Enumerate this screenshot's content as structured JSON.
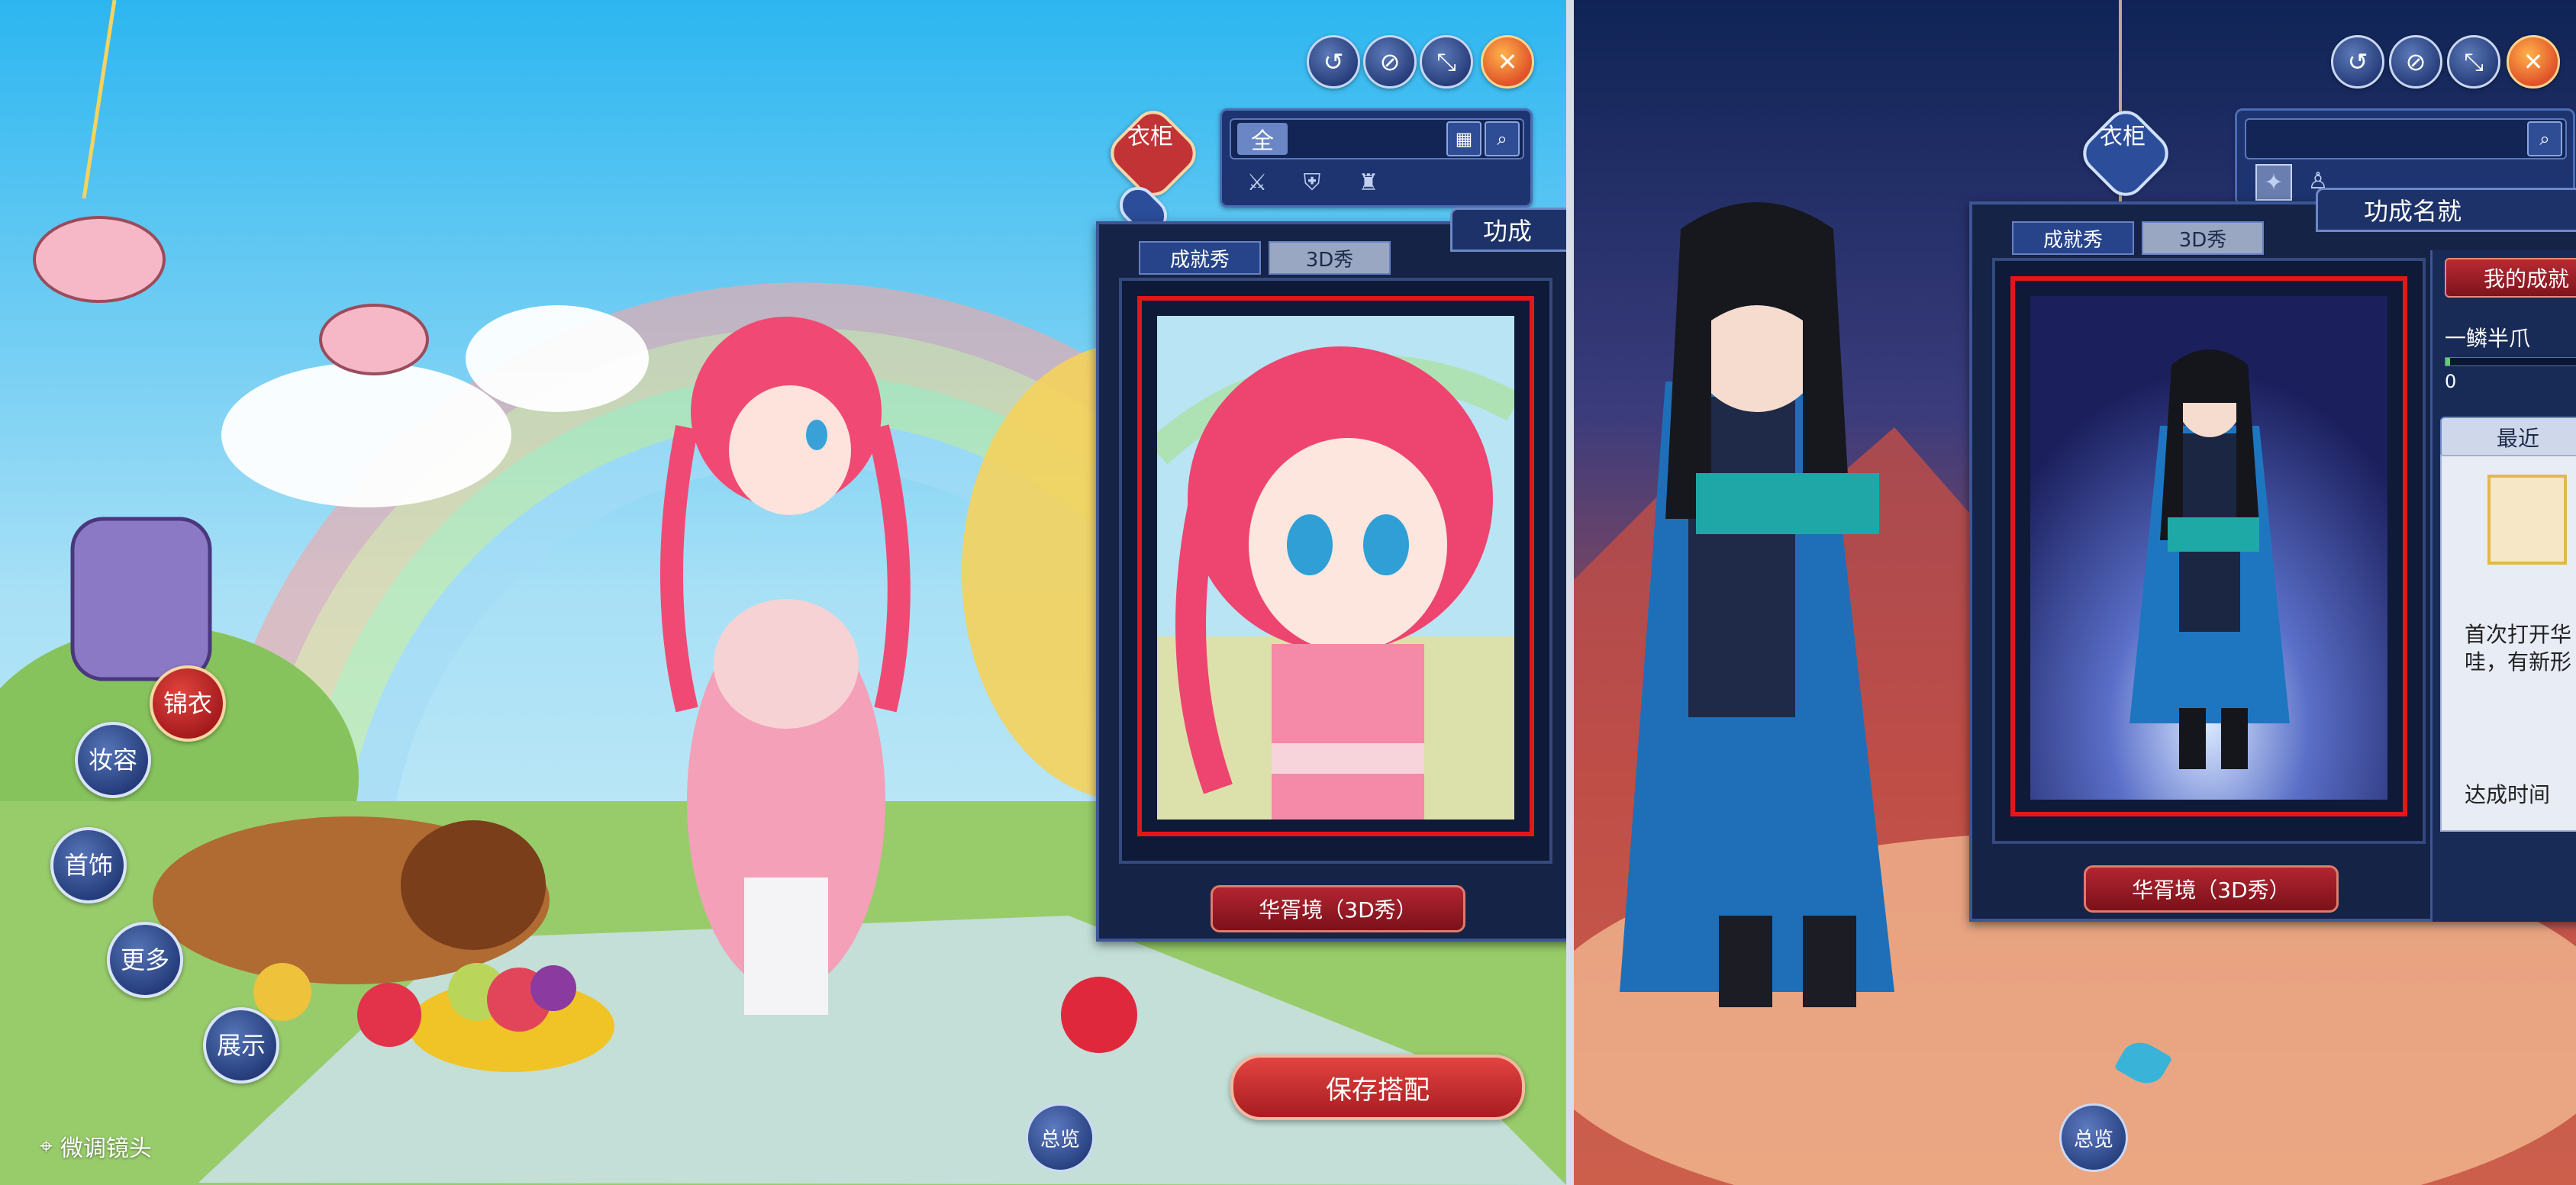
{
  "left": {
    "toolbar": {
      "icons": [
        "undo-icon",
        "hide-eye-icon",
        "collapse-icon",
        "close-icon"
      ],
      "glyphs": [
        "↺",
        "⊘",
        "⤡",
        "✕"
      ]
    },
    "wardrobe_tab": "衣柜",
    "filter": {
      "all_tab": "全",
      "categories": [
        "weapon-icon",
        "armor-icon",
        "robe-icon"
      ]
    },
    "achievement_panel": {
      "header": "功成",
      "tabs": [
        "成就秀",
        "3D秀"
      ],
      "active_tab": 1,
      "caption": "华胥境（3D秀）"
    },
    "side_badges": {
      "brocade": "锦衣",
      "makeup": "妆容",
      "jewelry": "首饰",
      "more": "更多",
      "display": "展示"
    },
    "save_button": "保存搭配",
    "overview_button": "总览",
    "fine_tune": "微调镜头"
  },
  "right": {
    "toolbar": {
      "icons": [
        "undo-icon",
        "hide-eye-icon",
        "collapse-icon",
        "close-icon"
      ],
      "glyphs": [
        "↺",
        "⊘",
        "⤡",
        "✕"
      ]
    },
    "wardrobe_tab": "衣柜",
    "achievement_panel": {
      "header": "功成名就",
      "tabs": [
        "成就秀",
        "3D秀"
      ],
      "active_tab": 1,
      "caption": "华胥境（3D秀）",
      "my_achievements": "我的成就",
      "achievement_name": "一鳞半爪",
      "progress_value": "0",
      "progress_fraction": 0.03,
      "recent_tab": "最近",
      "recent_text_line1": "首次打开华",
      "recent_text_line2": "哇，有新形",
      "achieved_time": "达成时间"
    },
    "overview_button": "总览"
  },
  "colors": {
    "highlight_red": "#e1181a",
    "panel_navy": "#152346",
    "button_red": "#b22532"
  }
}
